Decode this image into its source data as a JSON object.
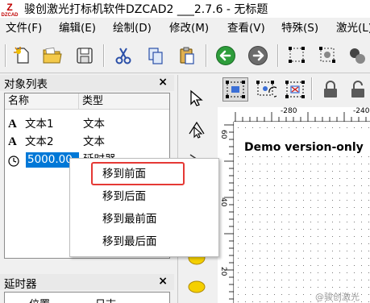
{
  "window": {
    "title": "骏创激光打标机软件DZCAD2 ___2.7.6 - 无标题",
    "app_icon_big": "Z",
    "app_icon_small": "DZCAD"
  },
  "menubar": {
    "items": [
      "文件(F)",
      "编辑(E)",
      "绘制(D)",
      "修改(M)",
      "查看(V)",
      "特殊(S)",
      "激光(L)"
    ]
  },
  "toolbar": {
    "buttons": [
      "new-icon",
      "open-icon",
      "save-icon",
      "cut-icon",
      "copy-icon",
      "paste-icon",
      "undo-icon",
      "redo-icon",
      "select-nodes-icon",
      "select-nodes-2-icon",
      "select-nodes-3-icon"
    ]
  },
  "object_list": {
    "title": "对象列表",
    "close": "×",
    "columns": [
      "名称",
      "类型"
    ],
    "rows": [
      {
        "icon": "A",
        "name": "文本1",
        "type": "文本"
      },
      {
        "icon": "A",
        "name": "文本2",
        "type": "文本"
      },
      {
        "icon": "clock-icon",
        "name": "5000.00",
        "type": "延时器"
      }
    ]
  },
  "delay_panel": {
    "title": "延时器",
    "close": "×",
    "columns": [
      "位置",
      "日志"
    ]
  },
  "canvas": {
    "ruler_top_labels": [
      "-280",
      "-240"
    ],
    "ruler_left_labels": [
      "60",
      "40",
      "20"
    ],
    "demo_text": "Demo version-only"
  },
  "context_menu": {
    "items": [
      "移到前面",
      "移到后面",
      "移到最前面",
      "移到最后面"
    ],
    "highlighted_index": 0,
    "highlight_color": "#e53935"
  },
  "watermark": "@骏创激光",
  "colors": {
    "selection": "#0078d7",
    "icon_red": "#c00000"
  }
}
